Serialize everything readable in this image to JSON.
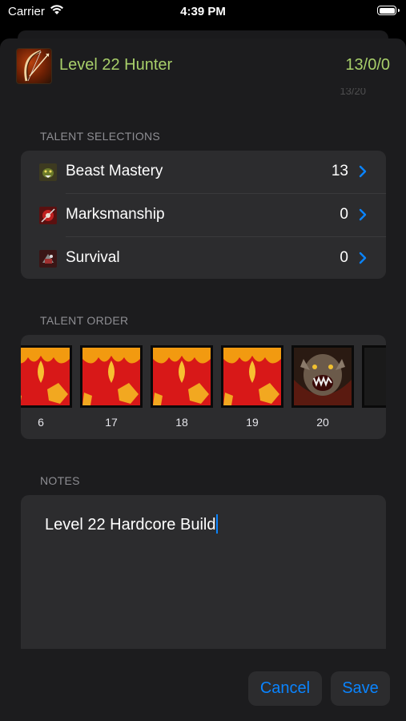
{
  "status_bar": {
    "carrier": "Carrier",
    "time": "4:39 PM"
  },
  "header": {
    "title": "Level 22 Hunter",
    "points": "13/0/0",
    "faded_text": "13/20"
  },
  "talent_selections": {
    "label": "TALENT SELECTIONS",
    "rows": [
      {
        "label": "Beast Mastery",
        "value": "13",
        "icon": "beast-mastery-icon"
      },
      {
        "label": "Marksmanship",
        "value": "0",
        "icon": "marksmanship-icon"
      },
      {
        "label": "Survival",
        "value": "0",
        "icon": "survival-icon"
      }
    ]
  },
  "talent_order": {
    "label": "TALENT ORDER",
    "items": [
      {
        "number": "6",
        "icon": "red-phoenix-talent-icon"
      },
      {
        "number": "17",
        "icon": "red-phoenix-talent-icon"
      },
      {
        "number": "18",
        "icon": "red-phoenix-talent-icon"
      },
      {
        "number": "19",
        "icon": "red-phoenix-talent-icon"
      },
      {
        "number": "20",
        "icon": "roaring-beast-talent-icon"
      }
    ]
  },
  "notes": {
    "label": "NOTES",
    "value": "Level 22 Hardcore Build"
  },
  "buttons": {
    "cancel": "Cancel",
    "save": "Save"
  },
  "colors": {
    "accent": "#0a84ff",
    "header_text": "#a8cf6a",
    "card": "#2c2c2e",
    "sheet": "#1c1c1e"
  }
}
